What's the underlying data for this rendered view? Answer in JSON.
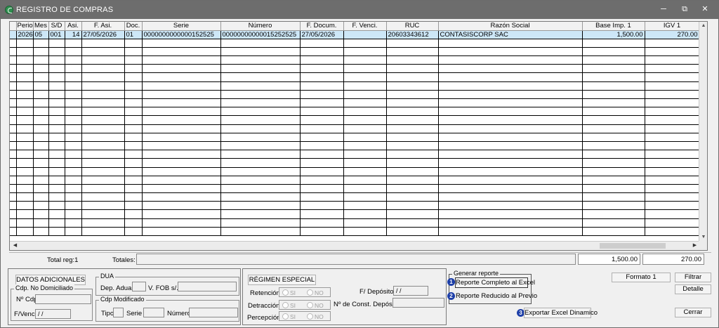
{
  "window": {
    "title": "REGISTRO DE COMPRAS",
    "controls": [
      "─",
      "⧉",
      "✕"
    ],
    "accent": "#2f8f4f"
  },
  "grid": {
    "columns": [
      "Period",
      "Mes",
      "S/D",
      "Asi.",
      "F. Asi.",
      "Doc.",
      "Serie",
      "Número",
      "F. Docum.",
      "F. Venci.",
      "RUC",
      "Razón Social",
      "Base Imp. 1",
      "IGV 1"
    ],
    "rows": [
      [
        "2026",
        "05",
        "001",
        "14",
        "27/05/2026",
        "01",
        "0000000000000152525",
        "00000000000015252525",
        "27/05/2026",
        "",
        "20603343612",
        "CONTASISCORP SAC",
        "1,500.00",
        "270.00"
      ]
    ],
    "selected_color": "#cde7f7"
  },
  "totals": {
    "total_reg_label": "Total reg:1",
    "totales_label": "Totales:",
    "base_total": "1,500.00",
    "igv_total": "270.00"
  },
  "datos_adicionales": {
    "title": "DATOS ADICIONALES",
    "no_domiciliado": {
      "legend": "Cdp. No Domiciliado",
      "ncdp_label": "Nº Cdp",
      "fvenc_label": "F/Venc.",
      "fvenc_value": "/ /"
    },
    "dua": {
      "legend": "DUA",
      "dep_label": "Dep. Adua.",
      "fob_label": "V. FOB s/.:"
    },
    "cdp_modificado": {
      "legend": "Cdp Modificado",
      "tipo_label": "Tipo",
      "serie_label": "Serie",
      "numero_label": "Número"
    }
  },
  "regimen": {
    "title": "RÉGIMEN ESPECIAL",
    "retencion": "Retención:",
    "detraccion": "Detracción:",
    "percepcion": "Percepción:",
    "si": "SI",
    "no": "NO",
    "fdeposito_label": "F/ Depósito:",
    "fdeposito_value": "/ /",
    "const_label": "Nº de Const. Depósito:"
  },
  "reporte": {
    "legend": "Generar reporte",
    "completo": "Reporte Completo al Excel",
    "reducido": "Reporte Reducido al Previo",
    "dinamico": "Exportar Excel Dinamico",
    "badges": [
      "1",
      "2",
      "3"
    ],
    "badge_color": "#1e3fa8"
  },
  "actions": {
    "formato": "Formato 1",
    "filtrar": "Filtrar",
    "detalle": "Detalle",
    "cerrar": "Cerrar"
  }
}
